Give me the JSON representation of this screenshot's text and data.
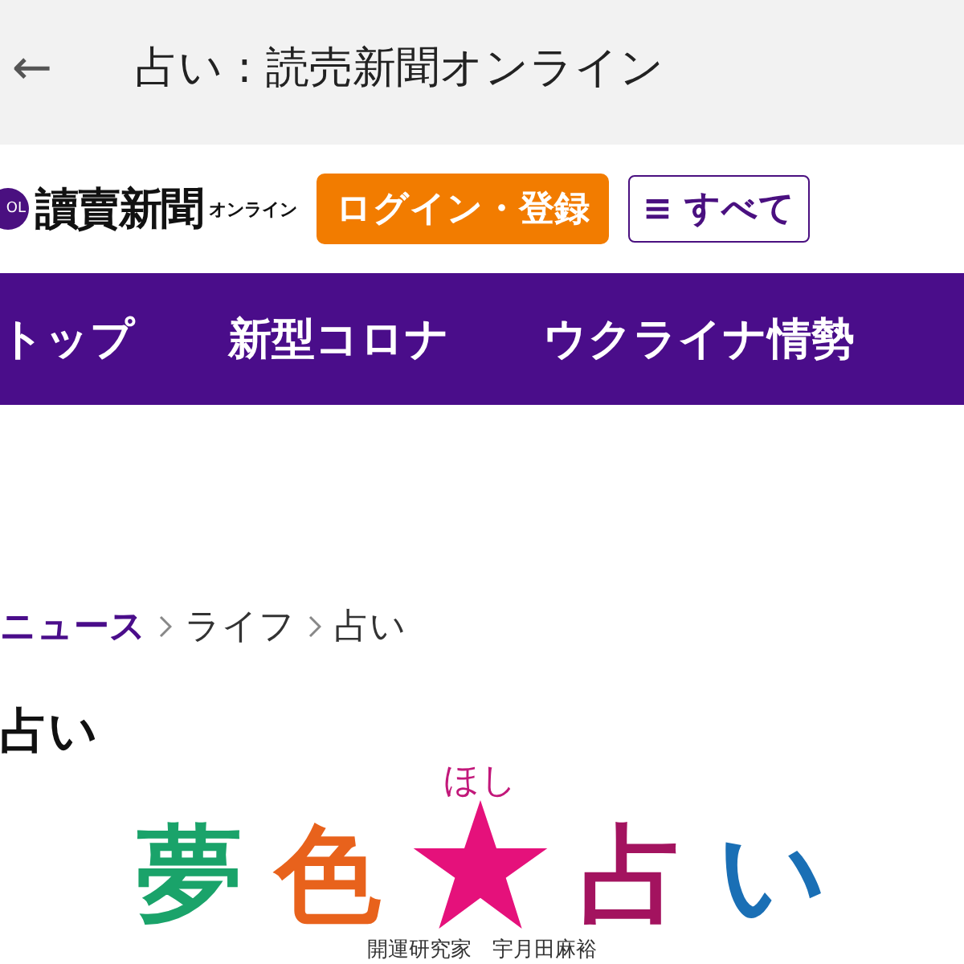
{
  "top_bar": {
    "back_icon": "←",
    "title": "占い : 読売新聞オンライン"
  },
  "header": {
    "logo_mark": "OL",
    "logo_text": "讀賣新聞",
    "logo_sub": "オンライン",
    "login_button": "ログイン・登録",
    "menu_button": {
      "icon": "≡",
      "label": "すべて"
    }
  },
  "nav": [
    {
      "label": "トップ"
    },
    {
      "label": "新型コロナ"
    },
    {
      "label": "ウクライナ情勢"
    }
  ],
  "breadcrumb": [
    {
      "label": "ニュース",
      "kind": "link"
    },
    {
      "label": "ライフ",
      "kind": "plain"
    },
    {
      "label": "占い",
      "kind": "plain"
    }
  ],
  "heading": "占い",
  "banner": {
    "title": [
      {
        "kind": "char",
        "text": "夢",
        "color": "#1aa36a"
      },
      {
        "kind": "char",
        "text": "色",
        "color": "#e8621c"
      },
      {
        "kind": "star",
        "ruby": "ほし",
        "color": "#e5117b"
      },
      {
        "kind": "char",
        "text": "占",
        "color": "#a3135f"
      },
      {
        "kind": "char",
        "text": "い",
        "color": "#1a6fb5"
      }
    ],
    "caption": "開運研究家　宇月田麻裕"
  }
}
